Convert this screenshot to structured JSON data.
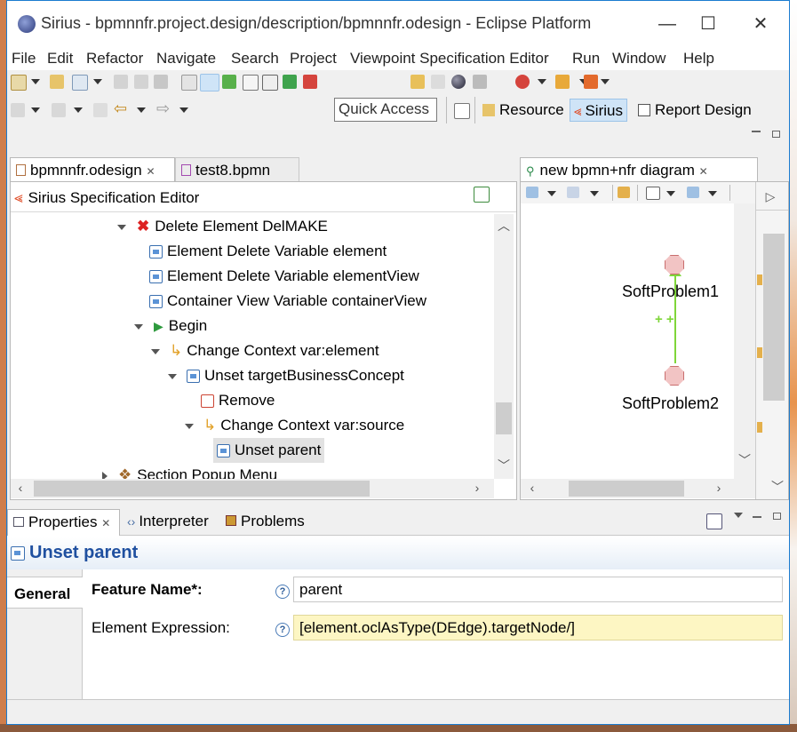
{
  "window": {
    "title": "Sirius - bpmnnfr.project.design/description/bpmnnfr.odesign - Eclipse Platform",
    "minimize": "—",
    "maximize": "☐",
    "close": "✕"
  },
  "menu": [
    "File",
    "Edit",
    "Refactor",
    "Navigate",
    "Search",
    "Project",
    "Viewpoint Specification Editor",
    "Run",
    "Window",
    "Help"
  ],
  "toolbar": {
    "quick_access": "Quick Access",
    "perspectives": [
      {
        "label": "Resource",
        "active": false
      },
      {
        "label": "Sirius",
        "active": true
      },
      {
        "label": "Report Design",
        "active": false
      }
    ]
  },
  "editor": {
    "tabs": [
      {
        "label": "bpmnnfr.odesign",
        "close": "✕",
        "active": true
      },
      {
        "label": "test8.bpmn",
        "active": false
      }
    ],
    "header": "Sirius Specification Editor",
    "tree": [
      {
        "label": "Delete Element DelMAKE",
        "icon": "red-x-icon",
        "exp": "open"
      },
      {
        "label": "Element Delete Variable element",
        "icon": "variable-icon",
        "exp": ""
      },
      {
        "label": "Element Delete Variable elementView",
        "icon": "variable-icon",
        "exp": ""
      },
      {
        "label": "Container View Variable containerView",
        "icon": "variable-icon",
        "exp": ""
      },
      {
        "label": "Begin",
        "icon": "play-icon",
        "exp": "open"
      },
      {
        "label": "Change Context var:element",
        "icon": "change-context-icon",
        "exp": "open"
      },
      {
        "label": "Unset targetBusinessConcept",
        "icon": "unset-icon",
        "exp": "open"
      },
      {
        "label": "Remove",
        "icon": "remove-icon",
        "exp": ""
      },
      {
        "label": "Change Context var:source",
        "icon": "change-context-icon",
        "exp": "open"
      },
      {
        "label": "Unset parent",
        "icon": "unset-icon",
        "exp": "",
        "selected": true
      },
      {
        "label": "Section Popup Menu",
        "icon": "section-icon",
        "exp": "closed"
      }
    ]
  },
  "diagram": {
    "tab": "new bpmn+nfr diagram",
    "close": "✕",
    "nodes": [
      "SoftProblem1",
      "SoftProblem2"
    ],
    "edge_label": "+ +"
  },
  "properties": {
    "tabs": [
      {
        "label": "Properties",
        "active": true,
        "close": "✕"
      },
      {
        "label": "Interpreter",
        "active": false
      },
      {
        "label": "Problems",
        "active": false
      }
    ],
    "title": "Unset parent",
    "section": "General",
    "feature_label": "Feature Name*:",
    "feature_value": "parent",
    "expr_label": "Element Expression:",
    "expr_value": "[element.oclAsType(DEdge).targetNode/]",
    "help": "?"
  },
  "colors": {
    "accent": "#1a7bd0",
    "expression_bg": "#fdf6c3",
    "selection": "#e0e0e0",
    "edge": "#7fd63a",
    "node_fill": "#f2c4c4"
  }
}
